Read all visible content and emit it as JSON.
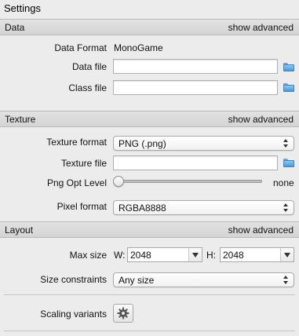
{
  "window": {
    "title": "Settings"
  },
  "sections": {
    "data": {
      "label": "Data",
      "advanced_link": "show advanced"
    },
    "texture": {
      "label": "Texture",
      "advanced_link": "show advanced"
    },
    "layout": {
      "label": "Layout",
      "advanced_link": "show advanced"
    }
  },
  "data": {
    "data_format_label": "Data Format",
    "data_format_value": "MonoGame",
    "data_file_label": "Data file",
    "data_file_value": "",
    "class_file_label": "Class file",
    "class_file_value": ""
  },
  "texture": {
    "texture_format_label": "Texture format",
    "texture_format_value": "PNG (.png)",
    "texture_file_label": "Texture file",
    "texture_file_value": "",
    "png_opt_level_label": "Png Opt Level",
    "png_opt_level_value_text": "none",
    "png_opt_level_fraction": 0,
    "pixel_format_label": "Pixel format",
    "pixel_format_value": "RGBA8888"
  },
  "layout": {
    "max_size_label": "Max size",
    "width_prefix": "W:",
    "width_value": "2048",
    "height_prefix": "H:",
    "height_value": "2048",
    "size_constraints_label": "Size constraints",
    "size_constraints_value": "Any size",
    "scaling_variants_label": "Scaling variants"
  },
  "icons": {
    "folder": "folder-icon",
    "gear": "gear-icon",
    "popup_arrows": "up-down-arrows-icon",
    "dropdown": "chevron-down-icon"
  }
}
